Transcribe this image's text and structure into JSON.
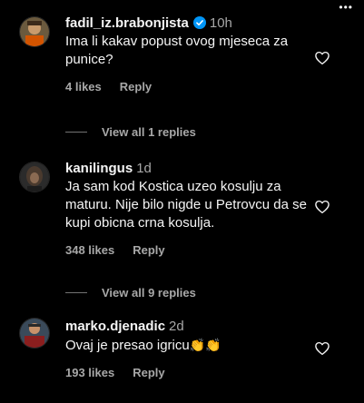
{
  "colors": {
    "background": "#000000",
    "text": "#f5f5f5",
    "muted": "#a8a8a8",
    "verified": "#0095f6"
  },
  "comments": [
    {
      "username": "fadil_iz.brabonjista",
      "verified": true,
      "time": "10h",
      "text": "Ima li kakav popust ovog mjeseca za punice?",
      "likes": "4 likes",
      "reply_label": "Reply",
      "view_replies": "View all 1 replies"
    },
    {
      "username": "kanilingus",
      "verified": false,
      "time": "1d",
      "text": "Ja sam kod Kostica uzeo kosulju za maturu. Nije bilo nigde u Petrovcu da se kupi obicna crna kosulja.",
      "likes": "348 likes",
      "reply_label": "Reply",
      "view_replies": "View all 9 replies"
    },
    {
      "username": "marko.djenadic",
      "verified": false,
      "time": "2d",
      "text": "Ovaj je presao igricu",
      "emoji": "👏👏",
      "likes": "193 likes",
      "reply_label": "Reply"
    }
  ]
}
